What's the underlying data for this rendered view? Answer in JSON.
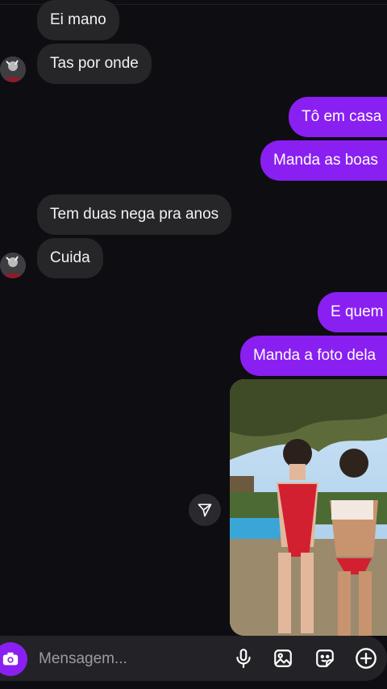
{
  "messages": [
    {
      "text": "Ei mano",
      "from": "them"
    },
    {
      "text": "Tas por onde",
      "from": "them"
    },
    {
      "text": "Tô em casa",
      "from": "me"
    },
    {
      "text": "Manda as boas",
      "from": "me"
    },
    {
      "text": "Tem duas nega pra anos",
      "from": "them"
    },
    {
      "text": "Cuida",
      "from": "them"
    },
    {
      "text": "E quem",
      "from": "me"
    },
    {
      "text": "Manda a foto dela",
      "from": "me"
    }
  ],
  "composer": {
    "placeholder": "Mensagem..."
  },
  "icons": {
    "camera": "camera-icon",
    "share": "paper-plane-icon",
    "mic": "microphone-icon",
    "gallery": "image-icon",
    "sticker": "sticker-icon",
    "more": "plus-circle-icon"
  },
  "colors": {
    "background": "#0d0d12",
    "incoming": "#262629",
    "outgoing": "#8a1ff2"
  }
}
